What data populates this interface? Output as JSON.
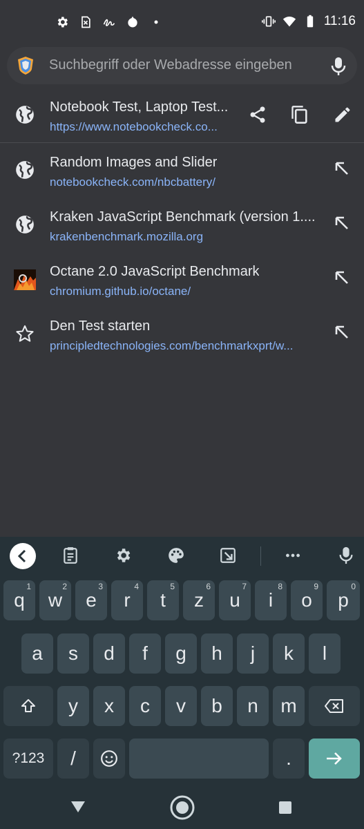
{
  "status_bar": {
    "time": "11:16",
    "left_icons": [
      "settings-icon",
      "sim-icon",
      "signature-icon",
      "app-icon",
      "dot-icon"
    ],
    "right_icons": [
      "vibrate-icon",
      "wifi-icon",
      "battery-icon"
    ]
  },
  "omnibox": {
    "placeholder": "Suchbegriff oder Webadresse eingeben"
  },
  "current_page": {
    "title": "Notebook Test, Laptop Test...",
    "url": "https://www.notebookcheck.co..."
  },
  "suggestions": [
    {
      "title": "Random Images and Slider",
      "url": "notebookcheck.com/nbcbattery/",
      "icon": "globe-icon"
    },
    {
      "title": "Kraken JavaScript Benchmark (version 1....",
      "url": "krakenbenchmark.mozilla.org",
      "icon": "globe-icon"
    },
    {
      "title": "Octane 2.0 JavaScript Benchmark",
      "url": "chromium.github.io/octane/",
      "icon": "octane-favicon"
    },
    {
      "title": "Den Test starten",
      "url": "principledtechnologies.com/benchmarkxprt/w...",
      "icon": "star-icon"
    }
  ],
  "keyboard": {
    "row1": [
      {
        "k": "q",
        "h": "1"
      },
      {
        "k": "w",
        "h": "2"
      },
      {
        "k": "e",
        "h": "3"
      },
      {
        "k": "r",
        "h": "4"
      },
      {
        "k": "t",
        "h": "5"
      },
      {
        "k": "z",
        "h": "6"
      },
      {
        "k": "u",
        "h": "7"
      },
      {
        "k": "i",
        "h": "8"
      },
      {
        "k": "o",
        "h": "9"
      },
      {
        "k": "p",
        "h": "0"
      }
    ],
    "row2": [
      "a",
      "s",
      "d",
      "f",
      "g",
      "h",
      "j",
      "k",
      "l"
    ],
    "row3": [
      "y",
      "x",
      "c",
      "v",
      "b",
      "n",
      "m"
    ],
    "symbols_label": "?123",
    "slash_label": "/",
    "period_label": "."
  },
  "colors": {
    "background": "#35363a",
    "link": "#8ab4f8",
    "keyboard_bg": "#263238",
    "enter_key": "#5fa8a1"
  }
}
